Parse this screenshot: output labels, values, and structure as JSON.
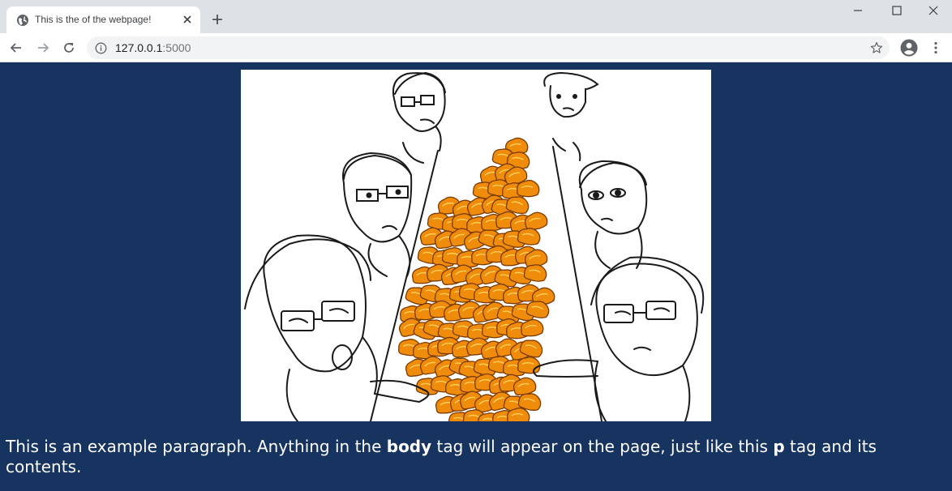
{
  "browser": {
    "tab_title": "This is the of the webpage!",
    "url_host": "127.0.0.1",
    "url_port": ":5000",
    "icons": {
      "favicon": "globe-icon",
      "close": "close-icon",
      "new_tab": "plus-icon",
      "minimize": "minimize-icon",
      "maximize": "maximize-icon",
      "window_close": "window-close-icon",
      "back": "back-arrow-icon",
      "forward": "forward-arrow-icon",
      "reload": "reload-icon",
      "site_info": "info-icon",
      "bookmark": "star-icon",
      "profile": "profile-icon",
      "menu": "kebab-menu-icon"
    }
  },
  "page": {
    "background_color": "#173461",
    "image": {
      "description": "cartoon"
    },
    "paragraph": {
      "part1": "This is an example paragraph. Anything in the ",
      "bold1": "body",
      "part2": " tag will appear on the page, just like this ",
      "bold2": "p",
      "part3": " tag and its contents."
    }
  }
}
